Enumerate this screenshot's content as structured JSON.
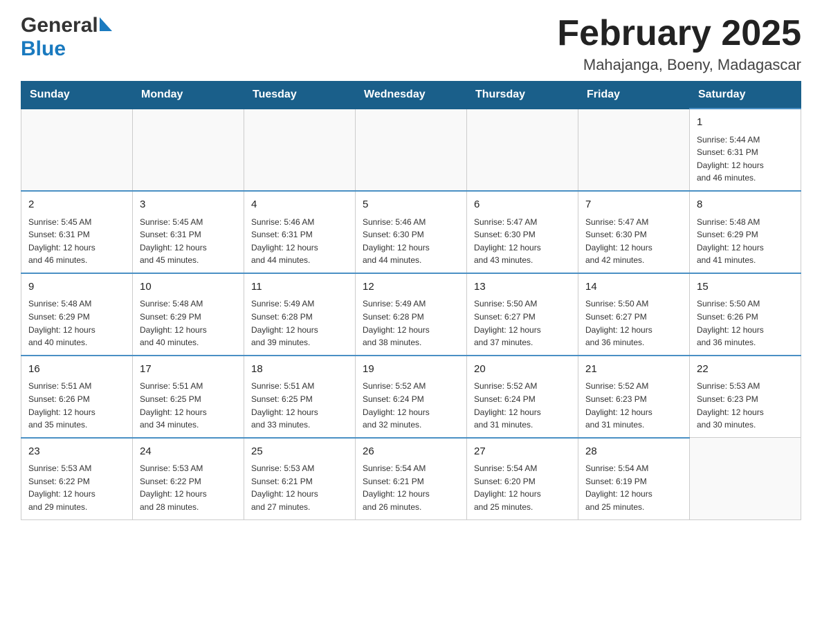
{
  "header": {
    "logo_general": "General",
    "logo_blue": "Blue",
    "month_title": "February 2025",
    "location": "Mahajanga, Boeny, Madagascar"
  },
  "weekdays": [
    "Sunday",
    "Monday",
    "Tuesday",
    "Wednesday",
    "Thursday",
    "Friday",
    "Saturday"
  ],
  "weeks": [
    [
      {
        "day": "",
        "info": ""
      },
      {
        "day": "",
        "info": ""
      },
      {
        "day": "",
        "info": ""
      },
      {
        "day": "",
        "info": ""
      },
      {
        "day": "",
        "info": ""
      },
      {
        "day": "",
        "info": ""
      },
      {
        "day": "1",
        "info": "Sunrise: 5:44 AM\nSunset: 6:31 PM\nDaylight: 12 hours\nand 46 minutes."
      }
    ],
    [
      {
        "day": "2",
        "info": "Sunrise: 5:45 AM\nSunset: 6:31 PM\nDaylight: 12 hours\nand 46 minutes."
      },
      {
        "day": "3",
        "info": "Sunrise: 5:45 AM\nSunset: 6:31 PM\nDaylight: 12 hours\nand 45 minutes."
      },
      {
        "day": "4",
        "info": "Sunrise: 5:46 AM\nSunset: 6:31 PM\nDaylight: 12 hours\nand 44 minutes."
      },
      {
        "day": "5",
        "info": "Sunrise: 5:46 AM\nSunset: 6:30 PM\nDaylight: 12 hours\nand 44 minutes."
      },
      {
        "day": "6",
        "info": "Sunrise: 5:47 AM\nSunset: 6:30 PM\nDaylight: 12 hours\nand 43 minutes."
      },
      {
        "day": "7",
        "info": "Sunrise: 5:47 AM\nSunset: 6:30 PM\nDaylight: 12 hours\nand 42 minutes."
      },
      {
        "day": "8",
        "info": "Sunrise: 5:48 AM\nSunset: 6:29 PM\nDaylight: 12 hours\nand 41 minutes."
      }
    ],
    [
      {
        "day": "9",
        "info": "Sunrise: 5:48 AM\nSunset: 6:29 PM\nDaylight: 12 hours\nand 40 minutes."
      },
      {
        "day": "10",
        "info": "Sunrise: 5:48 AM\nSunset: 6:29 PM\nDaylight: 12 hours\nand 40 minutes."
      },
      {
        "day": "11",
        "info": "Sunrise: 5:49 AM\nSunset: 6:28 PM\nDaylight: 12 hours\nand 39 minutes."
      },
      {
        "day": "12",
        "info": "Sunrise: 5:49 AM\nSunset: 6:28 PM\nDaylight: 12 hours\nand 38 minutes."
      },
      {
        "day": "13",
        "info": "Sunrise: 5:50 AM\nSunset: 6:27 PM\nDaylight: 12 hours\nand 37 minutes."
      },
      {
        "day": "14",
        "info": "Sunrise: 5:50 AM\nSunset: 6:27 PM\nDaylight: 12 hours\nand 36 minutes."
      },
      {
        "day": "15",
        "info": "Sunrise: 5:50 AM\nSunset: 6:26 PM\nDaylight: 12 hours\nand 36 minutes."
      }
    ],
    [
      {
        "day": "16",
        "info": "Sunrise: 5:51 AM\nSunset: 6:26 PM\nDaylight: 12 hours\nand 35 minutes."
      },
      {
        "day": "17",
        "info": "Sunrise: 5:51 AM\nSunset: 6:25 PM\nDaylight: 12 hours\nand 34 minutes."
      },
      {
        "day": "18",
        "info": "Sunrise: 5:51 AM\nSunset: 6:25 PM\nDaylight: 12 hours\nand 33 minutes."
      },
      {
        "day": "19",
        "info": "Sunrise: 5:52 AM\nSunset: 6:24 PM\nDaylight: 12 hours\nand 32 minutes."
      },
      {
        "day": "20",
        "info": "Sunrise: 5:52 AM\nSunset: 6:24 PM\nDaylight: 12 hours\nand 31 minutes."
      },
      {
        "day": "21",
        "info": "Sunrise: 5:52 AM\nSunset: 6:23 PM\nDaylight: 12 hours\nand 31 minutes."
      },
      {
        "day": "22",
        "info": "Sunrise: 5:53 AM\nSunset: 6:23 PM\nDaylight: 12 hours\nand 30 minutes."
      }
    ],
    [
      {
        "day": "23",
        "info": "Sunrise: 5:53 AM\nSunset: 6:22 PM\nDaylight: 12 hours\nand 29 minutes."
      },
      {
        "day": "24",
        "info": "Sunrise: 5:53 AM\nSunset: 6:22 PM\nDaylight: 12 hours\nand 28 minutes."
      },
      {
        "day": "25",
        "info": "Sunrise: 5:53 AM\nSunset: 6:21 PM\nDaylight: 12 hours\nand 27 minutes."
      },
      {
        "day": "26",
        "info": "Sunrise: 5:54 AM\nSunset: 6:21 PM\nDaylight: 12 hours\nand 26 minutes."
      },
      {
        "day": "27",
        "info": "Sunrise: 5:54 AM\nSunset: 6:20 PM\nDaylight: 12 hours\nand 25 minutes."
      },
      {
        "day": "28",
        "info": "Sunrise: 5:54 AM\nSunset: 6:19 PM\nDaylight: 12 hours\nand 25 minutes."
      },
      {
        "day": "",
        "info": ""
      }
    ]
  ]
}
